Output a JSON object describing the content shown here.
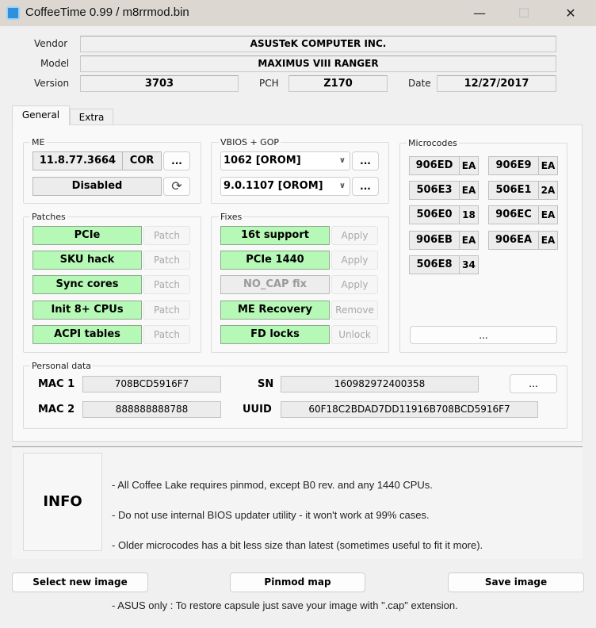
{
  "window": {
    "title": "CoffeeTime 0.99  /  m8rrmod.bin",
    "minimize": "—",
    "maximize": "☐",
    "close": "✕"
  },
  "header": {
    "vendor_label": "Vendor",
    "vendor": "ASUSTeK COMPUTER INC.",
    "model_label": "Model",
    "model": "MAXIMUS VIII RANGER",
    "version_label": "Version",
    "version": "3703",
    "pch_label": "PCH",
    "pch": "Z170",
    "date_label": "Date",
    "date": "12/27/2017"
  },
  "tabs": [
    {
      "label": "General"
    },
    {
      "label": "Extra"
    }
  ],
  "me": {
    "label": "ME",
    "version": "11.8.77.3664",
    "type": "COR",
    "more": "...",
    "state": "Disabled"
  },
  "vbios": {
    "label": "VBIOS + GOP",
    "vbios": "1062 [OROM]",
    "gop": "9.0.1107 [OROM]",
    "more": "..."
  },
  "patches": {
    "label": "Patches",
    "items": [
      {
        "name": "PCIe",
        "action": "Patch"
      },
      {
        "name": "SKU hack",
        "action": "Patch"
      },
      {
        "name": "Sync cores",
        "action": "Patch"
      },
      {
        "name": "Init 8+ CPUs",
        "action": "Patch"
      },
      {
        "name": "ACPI tables",
        "action": "Patch"
      }
    ]
  },
  "fixes": {
    "label": "Fixes",
    "items": [
      {
        "name": "16t support",
        "action": "Apply"
      },
      {
        "name": "PCIe 1440",
        "action": "Apply"
      },
      {
        "name": "NO_CAP fix",
        "action": "Apply"
      },
      {
        "name": "ME Recovery",
        "action": "Remove"
      },
      {
        "name": "FD locks",
        "action": "Unlock"
      }
    ]
  },
  "microcodes": {
    "label": "Microcodes",
    "items": [
      {
        "cpuid": "906ED",
        "rev": "EA"
      },
      {
        "cpuid": "906E9",
        "rev": "EA"
      },
      {
        "cpuid": "506E3",
        "rev": "EA"
      },
      {
        "cpuid": "506E1",
        "rev": "2A"
      },
      {
        "cpuid": "506E0",
        "rev": "18"
      },
      {
        "cpuid": "906EC",
        "rev": "EA"
      },
      {
        "cpuid": "906EB",
        "rev": "EA"
      },
      {
        "cpuid": "906EA",
        "rev": "EA"
      },
      {
        "cpuid": "506E8",
        "rev": "34"
      }
    ],
    "more": "..."
  },
  "personal": {
    "label": "Personal data",
    "mac1_label": "MAC 1",
    "mac1": "708BCD5916F7",
    "mac2_label": "MAC 2",
    "mac2": "888888888788",
    "sn_label": "SN",
    "sn": "160982972400358",
    "uuid_label": "UUID",
    "uuid": "60F18C2BDAD7DD11916B708BCD5916F7",
    "more": "..."
  },
  "info": {
    "title": "INFO",
    "lines": [
      "- All Coffee Lake requires pinmod, except B0 rev. and any 1440 CPUs.",
      "- Do not use internal BIOS updater utility - it won't work at 99% cases.",
      "- Older microcodes has a bit less size than latest (sometimes useful to fit it more).",
      "",
      "- ASUS only : To restore capsule just save your image with \".cap\" extension."
    ]
  },
  "buttons": {
    "select": "Select new image",
    "pinmod": "Pinmod map",
    "save": "Save image"
  }
}
